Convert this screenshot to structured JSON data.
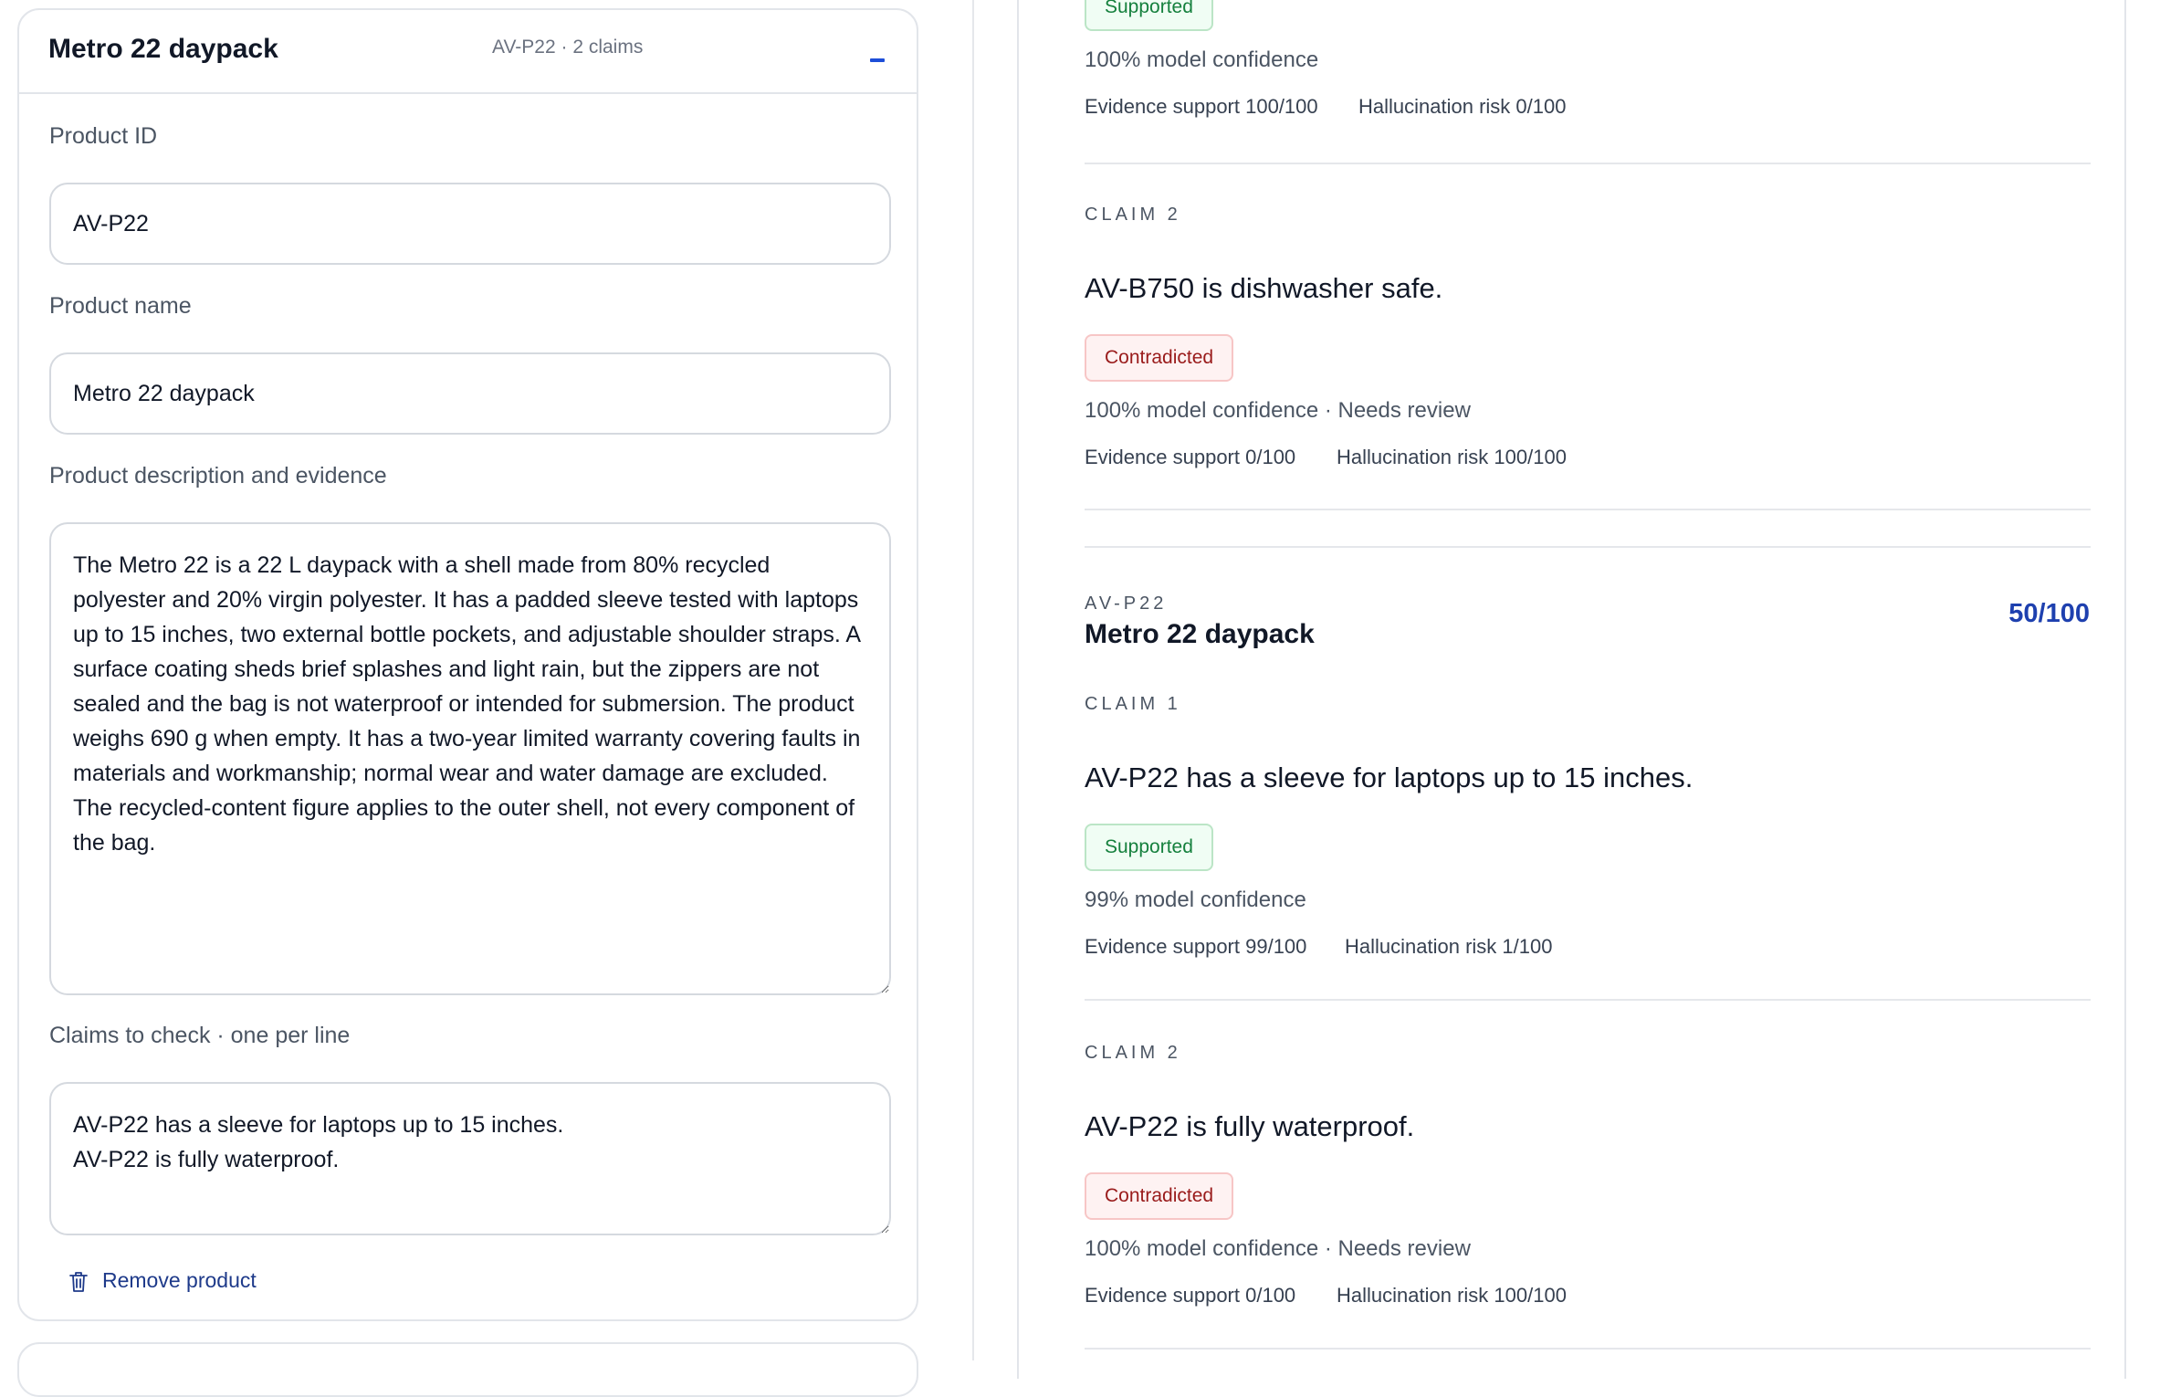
{
  "product_card": {
    "title": "Metro 22 daypack",
    "meta": "AV-P22 · 2 claims",
    "collapse_icon": "minus-icon",
    "product_id_label": "Product ID",
    "product_id_value": "AV-P22",
    "product_name_label": "Product name",
    "product_name_value": "Metro 22 daypack",
    "description_label": "Product description and evidence",
    "description_value": "The Metro 22 is a 22 L daypack with a shell made from 80% recycled polyester and 20% virgin polyester. It has a padded sleeve tested with laptops up to 15 inches, two external bottle pockets, and adjustable shoulder straps. A surface coating sheds brief splashes and light rain, but the zippers are not sealed and the bag is not waterproof or intended for submersion. The product weighs 690 g when empty. It has a two-year limited warranty covering faults in materials and workmanship; normal wear and water damage are excluded. The recycled-content figure applies to the outer shell, not every component of the bag.",
    "claims_label": "Claims to check · one per line",
    "claims_value": "AV-P22 has a sleeve for laptops up to 15 inches.\nAV-P22 is fully waterproof.",
    "remove_label": "Remove product",
    "remove_icon": "trash-icon"
  },
  "results": {
    "prev_claim_1": {
      "status": "Supported",
      "confidence": "100% model confidence",
      "evidence": "Evidence support 100/100",
      "risk": "Hallucination risk 0/100"
    },
    "prev_claim_2": {
      "label": "CLAIM 2",
      "text": "AV-B750 is dishwasher safe.",
      "status": "Contradicted",
      "confidence": "100% model confidence · Needs review",
      "evidence": "Evidence support 0/100",
      "risk": "Hallucination risk 100/100"
    },
    "product": {
      "id": "AV-P22",
      "name": "Metro 22 daypack",
      "score": "50/100",
      "claims": [
        {
          "label": "CLAIM 1",
          "text": "AV-P22 has a sleeve for laptops up to 15 inches.",
          "status": "Supported",
          "confidence": "99% model confidence",
          "evidence": "Evidence support 99/100",
          "risk": "Hallucination risk 1/100"
        },
        {
          "label": "CLAIM 2",
          "text": "AV-P22 is fully waterproof.",
          "status": "Contradicted",
          "confidence": "100% model confidence · Needs review",
          "evidence": "Evidence support 0/100",
          "risk": "Hallucination risk 100/100"
        }
      ]
    }
  },
  "colors": {
    "accent": "#1e40af",
    "supported_bg": "#f0fdf4",
    "supported_text": "#15803d",
    "contradicted_bg": "#fef2f2",
    "contradicted_text": "#991b1b"
  }
}
